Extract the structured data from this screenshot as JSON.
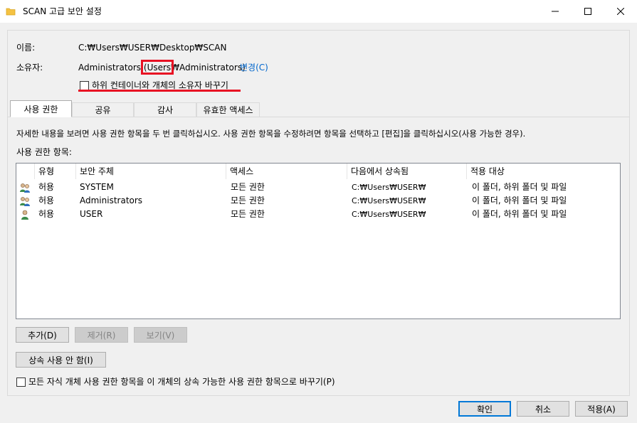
{
  "window": {
    "title": "SCAN 고급 보안 설정",
    "buttons": {
      "minimize": "—",
      "maximize": "☐",
      "close": "✕"
    }
  },
  "info": {
    "name_label": "이름:",
    "name_value": "C:₩Users₩USER₩Desktop₩SCAN",
    "owner_label": "소유자:",
    "owner_value_pre": "Administrators (",
    "owner_value_hl": "Users₩",
    "owner_value_post": "Administrators)",
    "change_link": "변경(C)",
    "replace_owner_checkbox": "하위 컨테이너와 개체의 소유자 바꾸기",
    "replace_owner_checked": false
  },
  "tabs": [
    {
      "label": "사용 권한",
      "active": true
    },
    {
      "label": "공유",
      "active": false
    },
    {
      "label": "감사",
      "active": false
    },
    {
      "label": "유효한 액세스",
      "active": false
    }
  ],
  "permissions": {
    "instructions": "자세한 내용을 보려면 사용 권한 항목을 두 번 클릭하십시오. 사용 권한 항목을 수정하려면 항목을 선택하고 [편집]을 클릭하십시오(사용 가능한 경우).",
    "entries_label": "사용 권한 항목:",
    "columns": [
      "유형",
      "보안 주체",
      "액세스",
      "다음에서 상속됨",
      "적용 대상"
    ],
    "rows": [
      {
        "icon": "users-group-icon",
        "type": "허용",
        "principal": "SYSTEM",
        "access": "모든 권한",
        "inherited": "C:₩Users₩USER₩",
        "applies": "이 폴더, 하위 폴더 및 파일"
      },
      {
        "icon": "users-group-icon",
        "type": "허용",
        "principal": "Administrators",
        "access": "모든 권한",
        "inherited": "C:₩Users₩USER₩",
        "applies": "이 폴더, 하위 폴더 및 파일"
      },
      {
        "icon": "user-icon",
        "type": "허용",
        "principal": "USER",
        "access": "모든 권한",
        "inherited": "C:₩Users₩USER₩",
        "applies": "이 폴더, 하위 폴더 및 파일"
      }
    ],
    "add_button": "추가(D)",
    "remove_button": "제거(R)",
    "view_button": "보기(V)",
    "disable_inheritance_button": "상속 사용 안 함(I)",
    "replace_child_checkbox": "모든 자식 개체 사용 권한 항목을 이 개체의 상속 가능한 사용 권한 항목으로 바꾸기(P)",
    "replace_child_checked": false
  },
  "footer": {
    "ok": "확인",
    "cancel": "취소",
    "apply": "적용(A)"
  },
  "colors": {
    "accent": "#0078d7",
    "link": "#0066cc",
    "highlight": "#e81123"
  }
}
